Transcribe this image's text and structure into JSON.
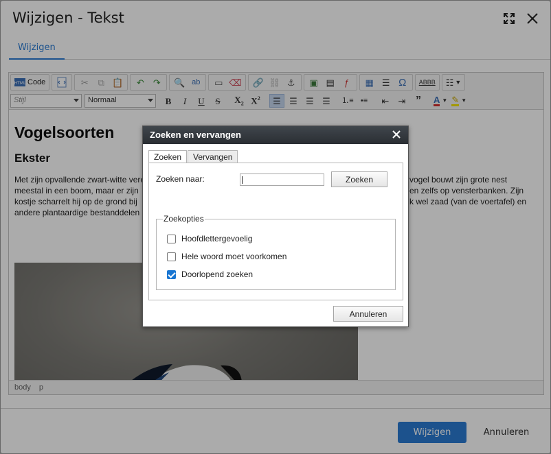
{
  "outer": {
    "title": "Wijzigen - Tekst",
    "tab_label": "Wijzigen",
    "save_label": "Wijzigen",
    "cancel_label": "Annuleren"
  },
  "toolbar": {
    "code_label": "Code",
    "style_select": "Stijl",
    "format_select": "Normaal"
  },
  "content": {
    "heading1": "Vogelsoorten",
    "heading2": "Ekster",
    "paragraph_left_1": "Met zijn opvallende zwart-witte vere",
    "paragraph_left_2": "meestal in een boom, maar er zijn",
    "paragraph_left_3": "kostje scharrelt hij op de grond bij",
    "paragraph_left_4": "andere plantaardige bestanddelen",
    "paragraph_right_1": "vogel bouwt zijn grote nest",
    "paragraph_right_2": "en zelfs op vensterbanken. Zijn",
    "paragraph_right_3": "k wel zaad (van de voertafel) en"
  },
  "statusbar": {
    "path_body": "body",
    "path_p": "p"
  },
  "find_dialog": {
    "title": "Zoeken en vervangen",
    "tabs": [
      "Zoeken",
      "Vervangen"
    ],
    "find_label": "Zoeken naar:",
    "find_value": "",
    "find_button": "Zoeken",
    "options_legend": "Zoekopties",
    "options": [
      {
        "label": "Hoofdlettergevoelig",
        "checked": false
      },
      {
        "label": "Hele woord moet voorkomen",
        "checked": false
      },
      {
        "label": "Doorlopend zoeken",
        "checked": true
      }
    ],
    "cancel_button": "Annuleren"
  },
  "colors": {
    "accent": "#2a7bd3",
    "checkbox_checked": "#1976d2",
    "dialog_title_bg": "#2f3338"
  }
}
